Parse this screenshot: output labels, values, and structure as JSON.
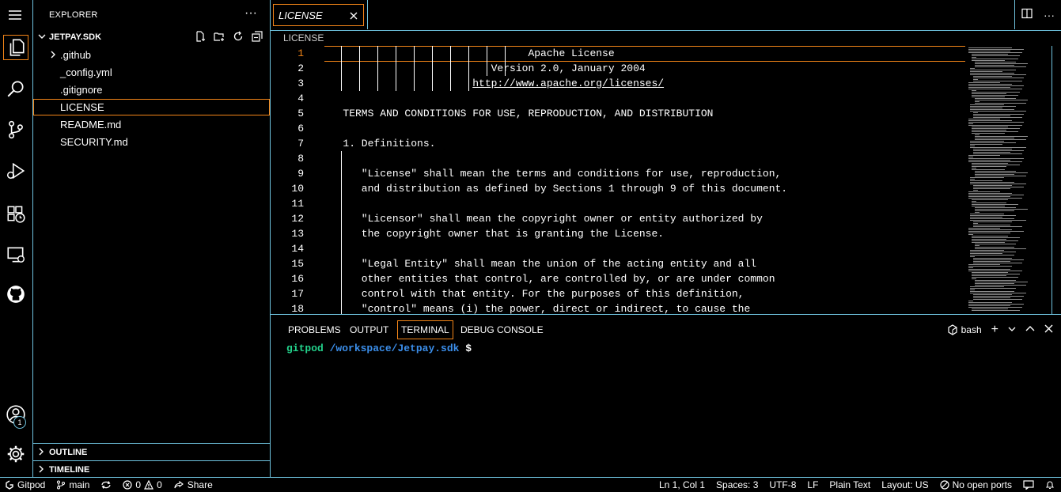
{
  "sidebar": {
    "title": "EXPLORER",
    "more": "···",
    "folder": "JETPAY.SDK",
    "items": [
      {
        "label": ".github",
        "folder": true
      },
      {
        "label": "_config.yml",
        "folder": false
      },
      {
        "label": ".gitignore",
        "folder": false
      },
      {
        "label": "LICENSE",
        "folder": false,
        "selected": true
      },
      {
        "label": "README.md",
        "folder": false
      },
      {
        "label": "SECURITY.md",
        "folder": false
      }
    ],
    "outline": "OUTLINE",
    "timeline": "TIMELINE"
  },
  "activity": {
    "accounts_badge": "1"
  },
  "editor": {
    "tab_label": "LICENSE",
    "breadcrumb": "LICENSE",
    "lines": [
      {
        "num": "1",
        "text": "                                 Apache License"
      },
      {
        "num": "2",
        "text": "                           Version 2.0, January 2004"
      },
      {
        "num": "3",
        "text": "                        ",
        "link": "http://www.apache.org/licenses/"
      },
      {
        "num": "4",
        "text": ""
      },
      {
        "num": "5",
        "text": "   TERMS AND CONDITIONS FOR USE, REPRODUCTION, AND DISTRIBUTION"
      },
      {
        "num": "6",
        "text": ""
      },
      {
        "num": "7",
        "text": "   1. Definitions."
      },
      {
        "num": "8",
        "text": ""
      },
      {
        "num": "9",
        "text": "      \"License\" shall mean the terms and conditions for use, reproduction,"
      },
      {
        "num": "10",
        "text": "      and distribution as defined by Sections 1 through 9 of this document."
      },
      {
        "num": "11",
        "text": ""
      },
      {
        "num": "12",
        "text": "      \"Licensor\" shall mean the copyright owner or entity authorized by"
      },
      {
        "num": "13",
        "text": "      the copyright owner that is granting the License."
      },
      {
        "num": "14",
        "text": ""
      },
      {
        "num": "15",
        "text": "      \"Legal Entity\" shall mean the union of the acting entity and all"
      },
      {
        "num": "16",
        "text": "      other entities that control, are controlled by, or are under common"
      },
      {
        "num": "17",
        "text": "      control with that entity. For the purposes of this definition,"
      },
      {
        "num": "18",
        "text": "      \"control\" means (i) the power, direct or indirect, to cause the"
      }
    ]
  },
  "panel": {
    "tabs": [
      "PROBLEMS",
      "OUTPUT",
      "TERMINAL",
      "DEBUG CONSOLE"
    ],
    "active_tab": "TERMINAL",
    "shell": "bash",
    "prompt_user": "gitpod",
    "prompt_path": "/workspace/Jetpay.sdk",
    "prompt_symbol": "$"
  },
  "statusbar": {
    "remote": "Gitpod",
    "branch": "main",
    "errors": "0",
    "warnings": "0",
    "share": "Share",
    "position": "Ln 1, Col 1",
    "spaces": "Spaces: 3",
    "encoding": "UTF-8",
    "eol": "LF",
    "language": "Plain Text",
    "layout": "Layout: US",
    "ports": "No open ports"
  },
  "colors": {
    "border": "#6fc3df",
    "focus": "#f38518",
    "terminal_user": "#23d18b",
    "terminal_path": "#3b8eea"
  }
}
